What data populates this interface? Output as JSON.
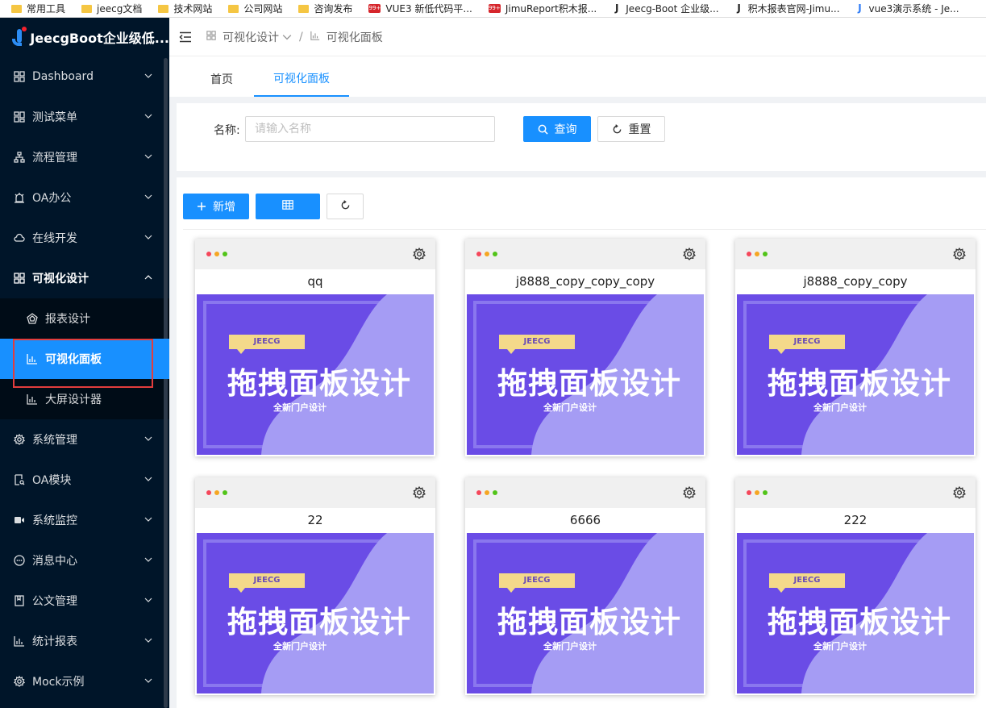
{
  "bookmarks": [
    {
      "label": "常用工具",
      "icon": "folder-icon"
    },
    {
      "label": "jeecg文档",
      "icon": "folder-icon"
    },
    {
      "label": "技术网站",
      "icon": "folder-icon"
    },
    {
      "label": "公司网站",
      "icon": "folder-icon"
    },
    {
      "label": "咨询发布",
      "icon": "folder-icon"
    },
    {
      "label": "VUE3 新低代码平...",
      "icon": "red-badge-icon",
      "badge": "99+"
    },
    {
      "label": "JimuReport积木报...",
      "icon": "red-badge-icon",
      "badge": "99+"
    },
    {
      "label": "Jeecg-Boot 企业级...",
      "icon": "j-icon"
    },
    {
      "label": "积木报表官网-Jimu...",
      "icon": "j-icon"
    },
    {
      "label": "vue3演示系统 - Je...",
      "icon": "j-blue-icon"
    }
  ],
  "app": {
    "title": "JeecgBoot企业级低..."
  },
  "sidebar": {
    "items": [
      {
        "label": "Dashboard",
        "icon": "dashboard-icon"
      },
      {
        "label": "测试菜单",
        "icon": "menu-test-icon"
      },
      {
        "label": "流程管理",
        "icon": "flow-icon"
      },
      {
        "label": "OA办公",
        "icon": "alarm-icon"
      },
      {
        "label": "在线开发",
        "icon": "cloud-icon"
      },
      {
        "label": "可视化设计",
        "icon": "grid-icon"
      },
      {
        "label": "系统管理",
        "icon": "gear-icon"
      },
      {
        "label": "OA模块",
        "icon": "document-search-icon"
      },
      {
        "label": "系统监控",
        "icon": "camera-icon"
      },
      {
        "label": "消息中心",
        "icon": "message-icon"
      },
      {
        "label": "公文管理",
        "icon": "book-icon"
      },
      {
        "label": "统计报表",
        "icon": "bar-chart-icon"
      },
      {
        "label": "Mock示例",
        "icon": "gear-icon"
      }
    ],
    "submenu": [
      {
        "label": "报表设计",
        "icon": "pentagon-icon"
      },
      {
        "label": "可视化面板",
        "icon": "bar-chart-icon"
      },
      {
        "label": "大屏设计器",
        "icon": "bar-chart-icon"
      }
    ]
  },
  "breadcrumb": {
    "parent": "可视化设计",
    "current": "可视化面板"
  },
  "tabs": [
    {
      "label": "首页"
    },
    {
      "label": "可视化面板"
    }
  ],
  "search": {
    "label": "名称:",
    "placeholder": "请输入名称",
    "value": "",
    "query_label": "查询",
    "reset_label": "重置"
  },
  "toolbar": {
    "add_label": "新增"
  },
  "cards": [
    {
      "title": "qq"
    },
    {
      "title": "j8888_copy_copy_copy"
    },
    {
      "title": "j8888_copy_copy"
    },
    {
      "title": "22"
    },
    {
      "title": "6666"
    },
    {
      "title": "222"
    }
  ],
  "thumbnail": {
    "tag": "JEECG",
    "headline": "拖拽面板设计",
    "subline": "全新门户设计"
  },
  "colors": {
    "primary": "#1890ff",
    "sidebar_bg": "#001529",
    "thumb_purple": "#6c4de8",
    "highlight_box": "#e23d3d"
  }
}
